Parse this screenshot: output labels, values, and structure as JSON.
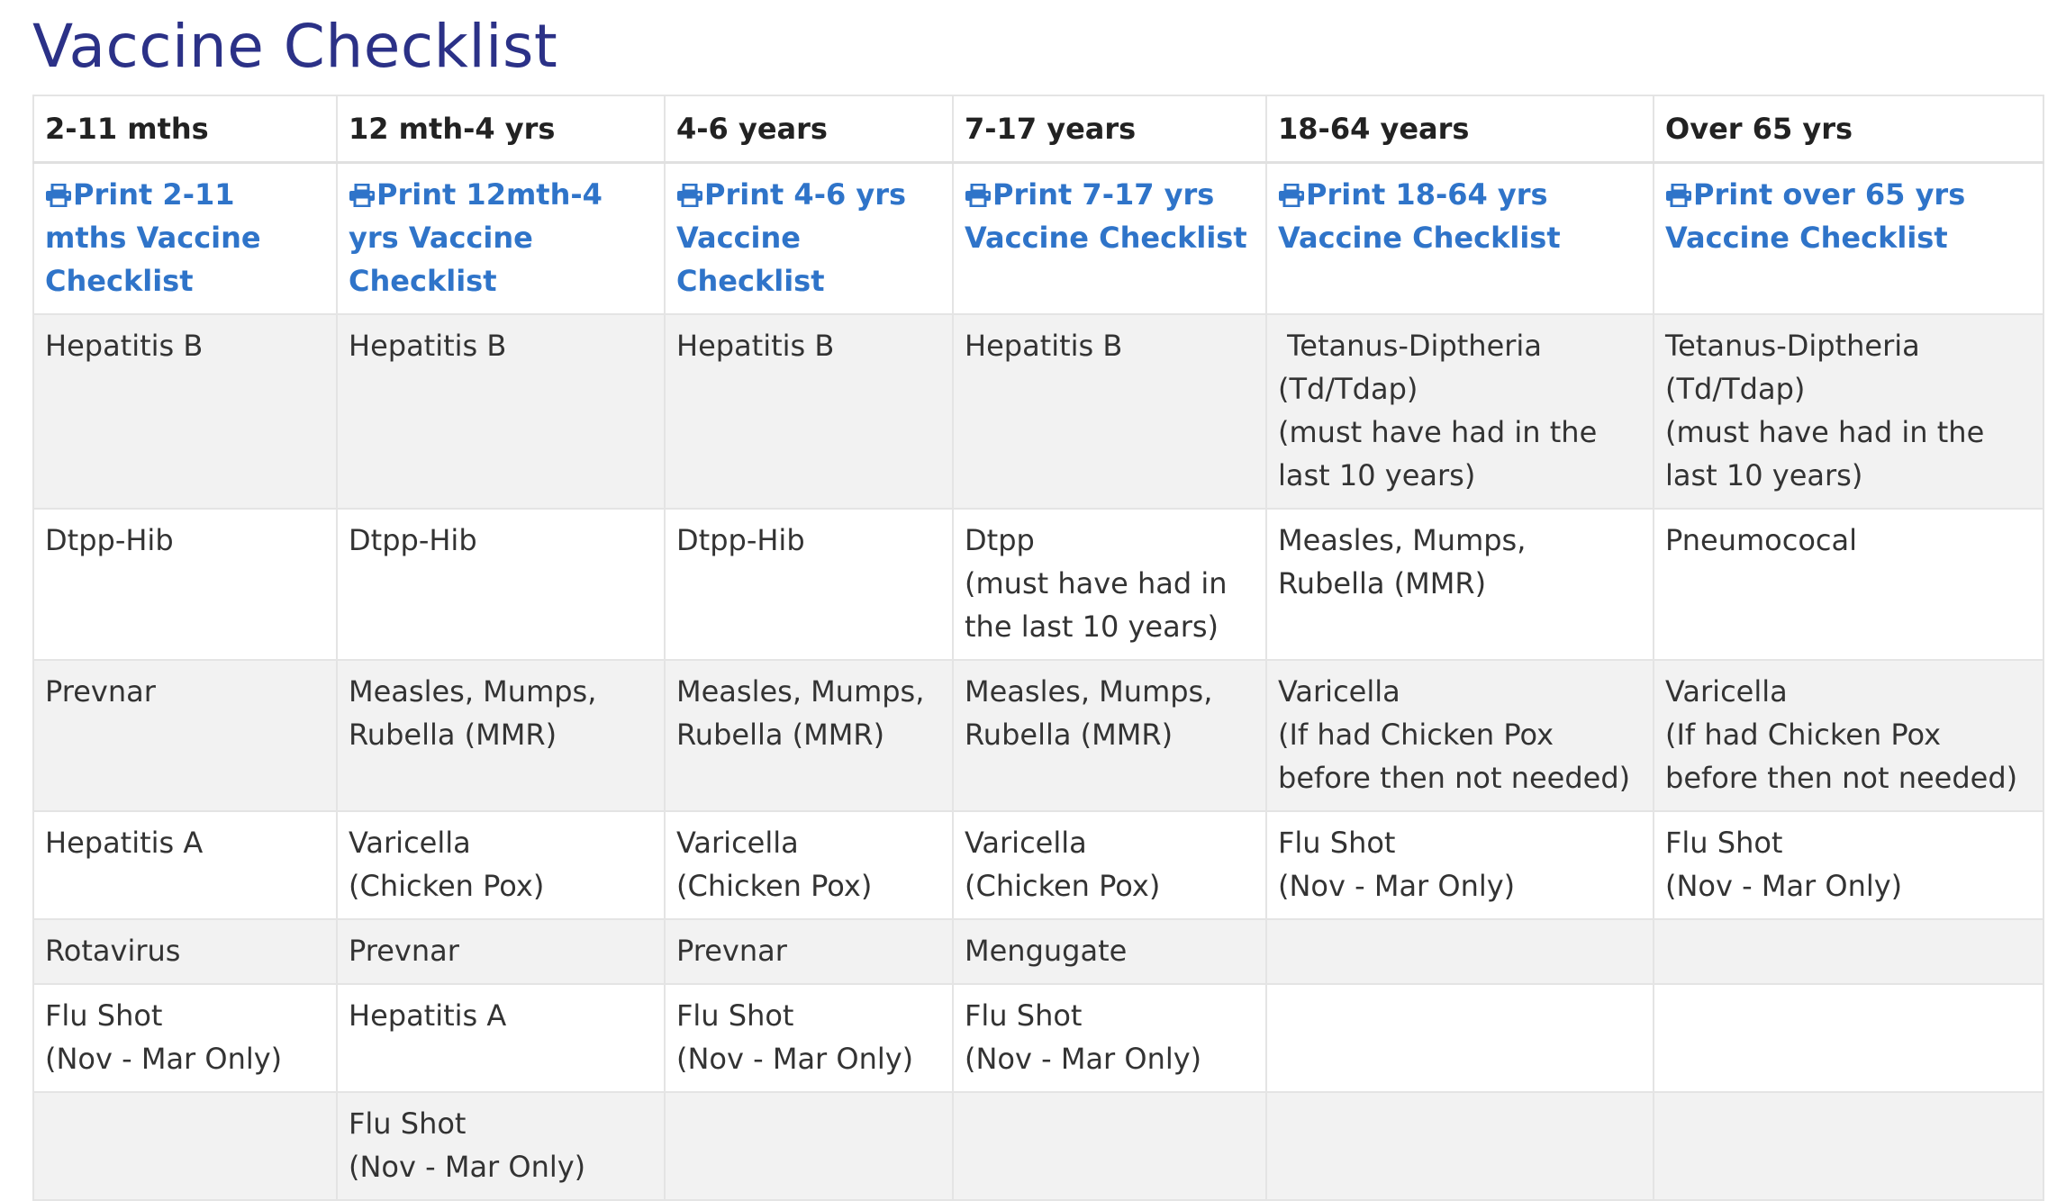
{
  "title": "Vaccine Checklist",
  "colors": {
    "title": "#2b3187",
    "link": "#2f74c9",
    "row_stripe": "#f2f2f2",
    "border": "#e4e4e4"
  },
  "icons": {
    "print": "printer-icon"
  },
  "headers": [
    "2-11 mths",
    "12 mth-4 yrs",
    "4-6 years",
    "7-17 years",
    "18-64 years",
    "Over 65 yrs"
  ],
  "print_links": [
    "Print 2-11 mths Vaccine Checklist",
    "Print 12mth-4 yrs Vaccine Checklist",
    "Print 4-6 yrs Vaccine Checklist",
    "Print 7-17 yrs Vaccine Checklist",
    "Print 18-64 yrs Vaccine Checklist",
    "Print over 65 yrs Vaccine Checklist"
  ],
  "rows": [
    [
      "Hepatitis B",
      "Hepatitis B",
      "Hepatitis B",
      "Hepatitis B",
      " Tetanus-Diptheria (Td/Tdap)\n(must have had in the last 10 years)",
      "Tetanus-Diptheria (Td/Tdap)\n(must have had in the last 10 years)"
    ],
    [
      "Dtpp-Hib",
      "Dtpp-Hib",
      "Dtpp-Hib",
      "Dtpp\n(must have had in the last 10 years)",
      "Measles, Mumps, Rubella (MMR)",
      "Pneumococal"
    ],
    [
      "Prevnar",
      "Measles, Mumps, Rubella (MMR)",
      "Measles, Mumps, Rubella (MMR)",
      "Measles, Mumps, Rubella (MMR)",
      "Varicella\n(If had Chicken Pox before then not needed)",
      "Varicella\n(If had Chicken Pox before then not needed)"
    ],
    [
      "Hepatitis A",
      "Varicella\n(Chicken Pox)",
      "Varicella\n(Chicken Pox)",
      "Varicella\n(Chicken Pox)",
      "Flu Shot\n(Nov - Mar Only)",
      "Flu Shot\n(Nov - Mar Only)"
    ],
    [
      "Rotavirus",
      "Prevnar",
      "Prevnar",
      "Mengugate",
      "",
      ""
    ],
    [
      "Flu Shot\n(Nov - Mar Only)",
      "Hepatitis A",
      "Flu Shot\n(Nov - Mar Only)",
      "Flu Shot\n(Nov - Mar Only)",
      "",
      ""
    ],
    [
      "",
      "Flu Shot\n(Nov - Mar Only)",
      "",
      "",
      "",
      ""
    ]
  ]
}
